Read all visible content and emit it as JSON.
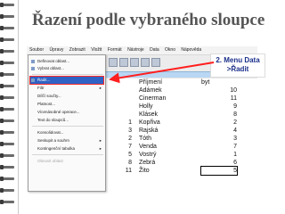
{
  "slide": {
    "title": "Řazení podle vybraného sloupce"
  },
  "annotation": {
    "line1": "2. Menu Data",
    "line2": ">Řadit"
  },
  "menubar": [
    "Soubor",
    "Úpravy",
    "Zobrazit",
    "Vložit",
    "Formát",
    "Nástroje",
    "Data",
    "Okno",
    "Nápověda"
  ],
  "data_menu": [
    {
      "label": "Definovat oblast...",
      "disabled": false
    },
    {
      "label": "Vybrat oblast...",
      "disabled": false
    },
    {
      "label": "Řadit...",
      "disabled": false,
      "highlighted": true
    },
    {
      "label": "Filtr",
      "disabled": false,
      "submenu": true
    },
    {
      "label": "Dílčí součty...",
      "disabled": false
    },
    {
      "label": "Platnost...",
      "disabled": false
    },
    {
      "label": "Vícenásobné operace...",
      "disabled": false
    },
    {
      "label": "Text do sloupců...",
      "disabled": false
    },
    {
      "label": "Konsolidovat...",
      "disabled": false
    },
    {
      "label": "Seskupit a souhrn",
      "disabled": false,
      "submenu": true
    },
    {
      "label": "Kontingenční tabulka",
      "disabled": false,
      "submenu": true
    },
    {
      "label": "Obnovit oblast",
      "disabled": true
    }
  ],
  "table": {
    "headers": [
      "Příjmení",
      "byt"
    ],
    "rows": [
      {
        "index": "",
        "surname": "Adámek",
        "byt": "10"
      },
      {
        "index": "",
        "surname": "Cinerman",
        "byt": "11"
      },
      {
        "index": "",
        "surname": "Holly",
        "byt": "9"
      },
      {
        "index": "",
        "surname": "Klásek",
        "byt": "8"
      },
      {
        "index": "1",
        "surname": "Kopřiva",
        "byt": "2"
      },
      {
        "index": "3",
        "surname": "Rajská",
        "byt": "4"
      },
      {
        "index": "2",
        "surname": "Tóth",
        "byt": "3"
      },
      {
        "index": "7",
        "surname": "Venda",
        "byt": "7"
      },
      {
        "index": "5",
        "surname": "Vostrý",
        "byt": "1"
      },
      {
        "index": "8",
        "surname": "Zebrá",
        "byt": "6"
      },
      {
        "index": "11",
        "surname": "Žito",
        "byt": "5"
      }
    ]
  },
  "colors": {
    "highlight": "#2f62c4",
    "arrow": "#ff1f1f",
    "annotation_text": "#1a2f8a"
  }
}
